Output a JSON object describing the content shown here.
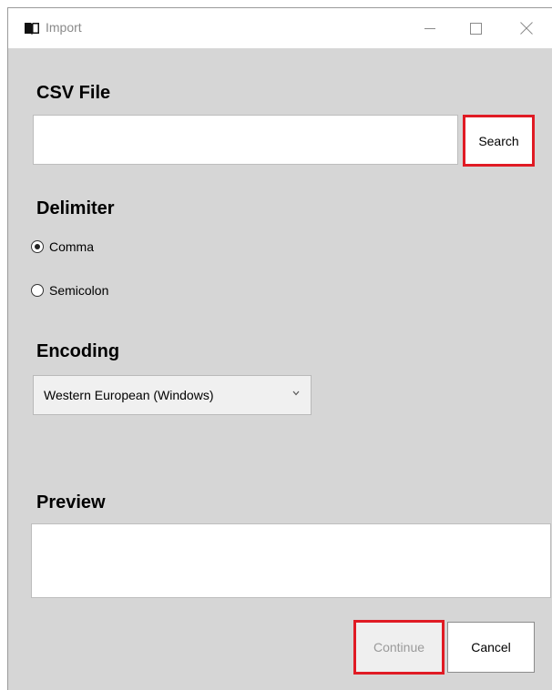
{
  "window": {
    "title": "Import",
    "app_icon": "book-icon",
    "controls": {
      "minimize": "minimize-icon",
      "maximize": "maximize-icon",
      "close": "close-icon"
    }
  },
  "csv_file": {
    "label": "CSV File",
    "value": "",
    "search_label": "Search"
  },
  "delimiter": {
    "label": "Delimiter",
    "options": [
      {
        "label": "Comma",
        "selected": true
      },
      {
        "label": "Semicolon",
        "selected": false
      }
    ]
  },
  "encoding": {
    "label": "Encoding",
    "selected": "Western European (Windows)"
  },
  "preview": {
    "label": "Preview",
    "content": ""
  },
  "actions": {
    "continue_label": "Continue",
    "continue_enabled": false,
    "cancel_label": "Cancel"
  },
  "colors": {
    "background": "#d6d6d6",
    "highlight": "#e01b24"
  }
}
